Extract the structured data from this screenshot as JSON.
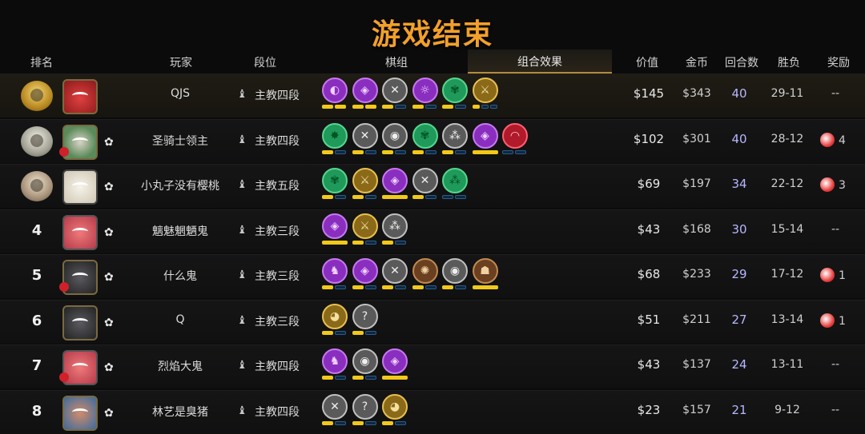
{
  "title": "游戏结束",
  "header": {
    "rank": "排名",
    "player": "玩家",
    "tier": "段位",
    "comp": "棋组",
    "synergy": "组合效果",
    "value": "价值",
    "gold": "金币",
    "rounds": "回合数",
    "winloss": "胜负",
    "reward": "奖励"
  },
  "rows": [
    {
      "rank": "",
      "medal": "gold",
      "avatar": "red",
      "rose": false,
      "little": false,
      "player": "QJS",
      "tier": "主教四段",
      "value": "$145",
      "gold": "$343",
      "rounds": "40",
      "wl": "29-11",
      "reward": "--",
      "reward_candy": false,
      "traits": [
        {
          "c": "purple",
          "g": "◐"
        },
        {
          "c": "purple",
          "g": "◈"
        },
        {
          "c": "silver",
          "g": "✕"
        },
        {
          "c": "purple",
          "g": "☼"
        },
        {
          "c": "green",
          "g": "✾"
        },
        {
          "c": "gold",
          "g": "⚔"
        }
      ],
      "pips": [
        [
          1,
          1
        ],
        [
          1,
          1
        ],
        [
          1,
          0
        ],
        [
          1,
          0
        ],
        [
          1,
          0
        ],
        [
          1,
          0,
          0
        ]
      ]
    },
    {
      "rank": "",
      "medal": "silver",
      "avatar": "horse",
      "rose": true,
      "little": true,
      "player": "圣骑士领主",
      "tier": "主教四段",
      "value": "$102",
      "gold": "$301",
      "rounds": "40",
      "wl": "28-12",
      "reward": "4",
      "reward_candy": true,
      "traits": [
        {
          "c": "green",
          "g": "✸"
        },
        {
          "c": "silver",
          "g": "✕"
        },
        {
          "c": "silver",
          "g": "◉"
        },
        {
          "c": "green",
          "g": "✾"
        },
        {
          "c": "silver",
          "g": "⁂"
        },
        {
          "c": "purple",
          "g": "◈"
        },
        {
          "c": "red",
          "g": "◠"
        }
      ],
      "pips": [
        [
          1,
          0
        ],
        [
          1,
          0
        ],
        [
          1,
          0
        ],
        [
          1,
          0
        ],
        [
          1,
          0
        ],
        [
          1
        ],
        [
          0,
          0
        ]
      ]
    },
    {
      "rank": "",
      "medal": "bronze",
      "avatar": "sheep",
      "rose": false,
      "little": true,
      "player": "小丸子没有樱桃",
      "tier": "主教五段",
      "value": "$69",
      "gold": "$197",
      "rounds": "34",
      "wl": "22-12",
      "reward": "3",
      "reward_candy": true,
      "traits": [
        {
          "c": "green",
          "g": "✾"
        },
        {
          "c": "gold",
          "g": "⚔"
        },
        {
          "c": "purple",
          "g": "◈"
        },
        {
          "c": "silver",
          "g": "✕"
        },
        {
          "c": "green",
          "g": "⁂"
        }
      ],
      "pips": [
        [
          1,
          0
        ],
        [
          1,
          0
        ],
        [
          1
        ],
        [
          1,
          0
        ],
        [
          0,
          0
        ]
      ]
    },
    {
      "rank": "4",
      "medal": "",
      "avatar": "pink",
      "rose": false,
      "little": true,
      "player": "魑魅魍魉鬼",
      "tier": "主教三段",
      "value": "$43",
      "gold": "$168",
      "rounds": "30",
      "wl": "15-14",
      "reward": "--",
      "reward_candy": false,
      "traits": [
        {
          "c": "purple",
          "g": "◈"
        },
        {
          "c": "gold",
          "g": "⚔"
        },
        {
          "c": "silver",
          "g": "⁂"
        }
      ],
      "pips": [
        [
          1
        ],
        [
          1,
          0
        ],
        [
          1,
          0
        ]
      ]
    },
    {
      "rank": "5",
      "medal": "",
      "avatar": "dark",
      "rose": true,
      "little": true,
      "player": "什么鬼",
      "tier": "主教三段",
      "value": "$68",
      "gold": "$233",
      "rounds": "29",
      "wl": "17-12",
      "reward": "1",
      "reward_candy": true,
      "traits": [
        {
          "c": "purple",
          "g": "♞"
        },
        {
          "c": "purple",
          "g": "◈"
        },
        {
          "c": "silver",
          "g": "✕"
        },
        {
          "c": "bronze",
          "g": "✺"
        },
        {
          "c": "silver",
          "g": "◉"
        },
        {
          "c": "bronze",
          "g": "☗"
        }
      ],
      "pips": [
        [
          1,
          0
        ],
        [
          1,
          0
        ],
        [
          1,
          0
        ],
        [
          1,
          0
        ],
        [
          1,
          0
        ],
        [
          1
        ]
      ]
    },
    {
      "rank": "6",
      "medal": "",
      "avatar": "dark",
      "rose": false,
      "little": true,
      "player": "Q",
      "tier": "主教三段",
      "value": "$51",
      "gold": "$211",
      "rounds": "27",
      "wl": "13-14",
      "reward": "1",
      "reward_candy": true,
      "traits": [
        {
          "c": "gold",
          "g": "◕"
        },
        {
          "c": "silver",
          "g": "?"
        }
      ],
      "pips": [
        [
          1,
          0
        ],
        [
          1,
          0
        ]
      ]
    },
    {
      "rank": "7",
      "medal": "",
      "avatar": "pink",
      "rose": true,
      "little": true,
      "player": "烈焰大鬼",
      "tier": "主教四段",
      "value": "$43",
      "gold": "$137",
      "rounds": "24",
      "wl": "13-11",
      "reward": "--",
      "reward_candy": false,
      "traits": [
        {
          "c": "purple",
          "g": "♞"
        },
        {
          "c": "silver",
          "g": "◉"
        },
        {
          "c": "purple",
          "g": "◈"
        }
      ],
      "pips": [
        [
          1,
          0
        ],
        [
          1,
          0
        ],
        [
          1
        ]
      ]
    },
    {
      "rank": "8",
      "medal": "",
      "avatar": "pig",
      "rose": false,
      "little": true,
      "player": "林艺是臭猪",
      "tier": "主教四段",
      "value": "$23",
      "gold": "$157",
      "rounds": "21",
      "wl": "9-12",
      "reward": "--",
      "reward_candy": false,
      "traits": [
        {
          "c": "silver",
          "g": "✕"
        },
        {
          "c": "silver",
          "g": "?"
        },
        {
          "c": "gold",
          "g": "◕"
        }
      ],
      "pips": [
        [
          1,
          0
        ],
        [
          1,
          0
        ],
        [
          1,
          0
        ]
      ]
    }
  ],
  "icons": {
    "tier": "bishop-icon",
    "little": "little-legend-icon",
    "reward": "candy-icon"
  }
}
